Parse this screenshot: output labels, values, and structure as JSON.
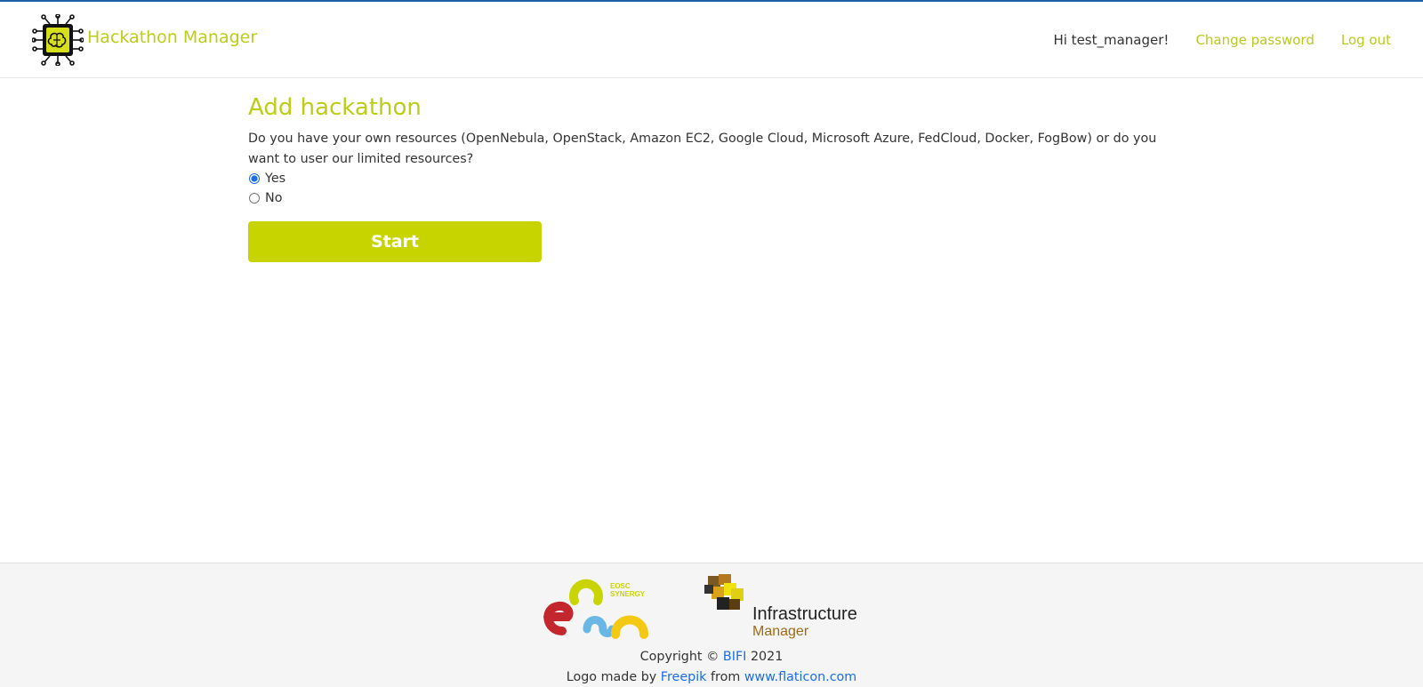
{
  "header": {
    "brand": "Hackathon Manager",
    "greeting": "Hi test_manager!",
    "change_password": "Change password",
    "log_out": "Log out"
  },
  "main": {
    "title": "Add hackathon",
    "question": "Do you have your own resources (OpenNebula, OpenStack, Amazon EC2, Google Cloud, Microsoft Azure, FedCloud, Docker, FogBow) or do you want to user our limited resources?",
    "options": [
      {
        "label": "Yes",
        "checked": true
      },
      {
        "label": "No",
        "checked": false
      }
    ],
    "start_label": "Start"
  },
  "footer": {
    "eosc_logo_text_1": "EOSC",
    "eosc_logo_text_2": "SYNERGY",
    "im_logo_text_1": "Infrastructure",
    "im_logo_text_2": "Manager",
    "copyright_prefix": "Copyright ©",
    "copyright_org": "BIFI",
    "copyright_year": "2021",
    "logo_credit_prefix": "Logo made by",
    "logo_author": "Freepik",
    "logo_from": "from",
    "logo_site": "www.flaticon.com"
  },
  "colors": {
    "accent": "#c8d400",
    "link": "#1a6de8",
    "brand_text": "#bccd18"
  },
  "icons": {
    "brand": "chip-brain-icon"
  }
}
